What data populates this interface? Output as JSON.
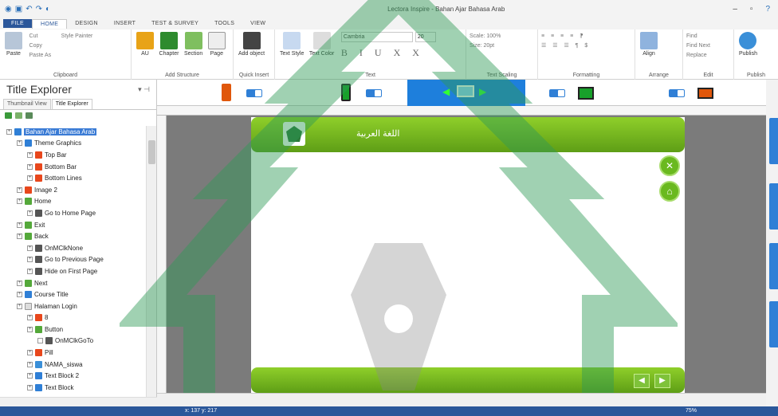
{
  "window": {
    "title": "Lectora Inspire - Bahan Ajar Bahasa Arab"
  },
  "tabs": [
    "FILE",
    "HOME",
    "DESIGN",
    "INSERT",
    "TEST & SURVEY",
    "TOOLS",
    "VIEW"
  ],
  "ribbon": {
    "clipboard": {
      "paste": "Paste",
      "cut": "Cut",
      "copy": "Copy",
      "paste_as": "Paste As",
      "style_painter": "Style Painter",
      "label": "Clipboard"
    },
    "add_structure": {
      "all": "AU",
      "chapter": "Chapter",
      "section": "Section",
      "page": "Page",
      "label": "Add Structure"
    },
    "quick_insert": {
      "add_object": "Add object",
      "label": "Quick Insert"
    },
    "text": {
      "text_style": "Text Style",
      "text_color": "Text Color",
      "font": "Cambria",
      "size": "20",
      "format_glyphs": "B I U X X",
      "label": "Text"
    },
    "text_scaling": {
      "scale": "Scale: 100%",
      "size": "Size: 20pt",
      "label": "Text Scaling"
    },
    "formatting": {
      "label": "Formatting"
    },
    "arrange": {
      "align": "Align",
      "label": "Arrange"
    },
    "edit": {
      "find": "Find",
      "find_next": "Find Next",
      "replace": "Replace",
      "label": "Edit"
    },
    "publish": {
      "publish": "Publish",
      "label": "Publish"
    }
  },
  "panel": {
    "title": "Title Explorer",
    "tabs": [
      "Thumbnail View",
      "Title Explorer"
    ],
    "tree": [
      {
        "label": "Bahan Ajar Bahasa Arab",
        "level": 0,
        "icon": "book",
        "selected": true
      },
      {
        "label": "Theme Graphics",
        "level": 1,
        "icon": "folder"
      },
      {
        "label": "Top Bar",
        "level": 2,
        "icon": "image"
      },
      {
        "label": "Bottom Bar",
        "level": 2,
        "icon": "image"
      },
      {
        "label": "Bottom Lines",
        "level": 2,
        "icon": "image"
      },
      {
        "label": "Image 2",
        "level": 1,
        "icon": "image"
      },
      {
        "label": "Home",
        "level": 1,
        "icon": "button"
      },
      {
        "label": "Go to Home Page",
        "level": 2,
        "icon": "action"
      },
      {
        "label": "Exit",
        "level": 1,
        "icon": "button"
      },
      {
        "label": "Back",
        "level": 1,
        "icon": "button"
      },
      {
        "label": "OnMClkNone",
        "level": 2,
        "icon": "action"
      },
      {
        "label": "Go to Previous Page",
        "level": 2,
        "icon": "action"
      },
      {
        "label": "Hide on First Page",
        "level": 2,
        "icon": "action"
      },
      {
        "label": "Next",
        "level": 1,
        "icon": "button"
      },
      {
        "label": "Course Title",
        "level": 1,
        "icon": "text"
      },
      {
        "label": "Halaman Login",
        "level": 1,
        "icon": "page"
      },
      {
        "label": "8",
        "level": 2,
        "icon": "image"
      },
      {
        "label": "Button",
        "level": 2,
        "icon": "button"
      },
      {
        "label": "OnMClkGoTo",
        "level": 3,
        "icon": "action"
      },
      {
        "label": "Pill",
        "level": 2,
        "icon": "image"
      },
      {
        "label": "NAMA_siswa",
        "level": 2,
        "icon": "field"
      },
      {
        "label": "Text Block 2",
        "level": 2,
        "icon": "text"
      },
      {
        "label": "Text Block",
        "level": 2,
        "icon": "text"
      }
    ]
  },
  "canvas": {
    "page_title": "اللغة العربية"
  },
  "status": {
    "coords": "x: 137 y: 217",
    "zoom": "75%"
  },
  "colors": {
    "accent": "#2b579a",
    "device_selected": "#1e7fdc",
    "green_bar": "#7dbf24",
    "selection": "#3a7bd5"
  }
}
